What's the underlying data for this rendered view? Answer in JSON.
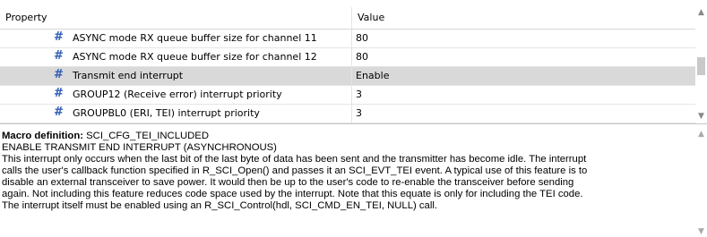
{
  "table": {
    "header": {
      "property": "Property",
      "value": "Value"
    },
    "rows": [
      {
        "icon": "#",
        "name": "ASYNC mode RX queue buffer size for channel 11",
        "value": "80",
        "selected": false
      },
      {
        "icon": "#",
        "name": "ASYNC mode RX queue buffer size for channel 12",
        "value": "80",
        "selected": false
      },
      {
        "icon": "#",
        "name": "Transmit end interrupt",
        "value": "Enable",
        "selected": true
      },
      {
        "icon": "#",
        "name": "GROUP12 (Receive error) interrupt priority",
        "value": "3",
        "selected": false
      },
      {
        "icon": "#",
        "name": "GROUPBL0 (ERI, TEI) interrupt priority",
        "value": "3",
        "selected": false
      }
    ]
  },
  "description": {
    "macro_label": "Macro definition:",
    "macro_value": " SCI_CFG_TEI_INCLUDED",
    "title": "ENABLE TRANSMIT END INTERRUPT (ASYNCHRONOUS)",
    "lines": [
      "This interrupt only occurs when the last bit of the last byte of data has been sent and the transmitter has become idle. The interrupt",
      "calls the user's callback function specified in R_SCI_Open() and passes it an SCI_EVT_TEI event. A typical use of this feature is to",
      "disable an external transceiver to save power. It would then be up to the user's code to re-enable the transceiver before sending",
      "again. Not including this feature reduces code space used by the interrupt. Note that this equate is only for including the TEI code.",
      "The interrupt itself must be enabled using an R_SCI_Control(hdl, SCI_CMD_EN_TEI, NULL) call."
    ]
  },
  "scroll": {
    "up_icon": "chevron-up-icon",
    "down_icon": "chevron-down-icon"
  }
}
